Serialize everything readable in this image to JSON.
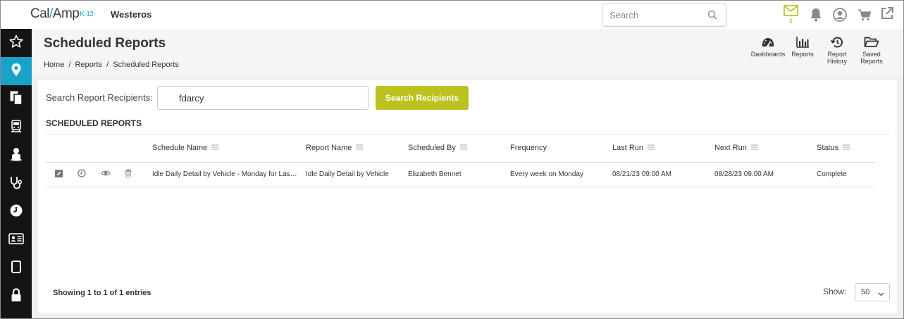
{
  "brand": {
    "name": "Cal",
    "name2": "Amp",
    "suffix": "K-12",
    "org": "Westeros",
    "accent": "#1aa3c8",
    "primary": "#bcc21f"
  },
  "topbar": {
    "search_placeholder": "Search",
    "mail_count": "1",
    "icons": [
      "mail-icon",
      "bell-icon",
      "user-circle-icon",
      "cart-icon",
      "external-link-icon"
    ]
  },
  "leftnav": {
    "items": [
      "star-icon",
      "map-pin-icon",
      "documents-icon",
      "bus-icon",
      "driver-icon",
      "stethoscope-icon",
      "clock-icon",
      "id-card-icon",
      "tablet-icon",
      "lock-icon"
    ],
    "active": "map-pin-icon"
  },
  "header": {
    "title": "Scheduled Reports",
    "breadcrumb": [
      "Home",
      "/",
      "Reports",
      "/",
      "Scheduled Reports"
    ],
    "quick_links": [
      {
        "label": "Dashboards",
        "icon": "dashboard-gauge-icon"
      },
      {
        "label": "Reports",
        "icon": "bar-chart-icon"
      },
      {
        "label": "Report History",
        "icon": "history-icon"
      },
      {
        "label": "Saved Reports",
        "icon": "folder-open-icon"
      }
    ]
  },
  "recipients": {
    "label": "Search Report Recipients:",
    "value": "fdarcy",
    "button": "Search Recipients"
  },
  "section_title": "SCHEDULED REPORTS",
  "table": {
    "columns": [
      "Schedule Name",
      "Report Name",
      "Scheduled By",
      "Frequency",
      "Last Run",
      "Next Run",
      "Status"
    ],
    "rows": [
      {
        "schedule_name": "Idle Daily Detail by Vehicle - Monday for Last Week",
        "report_name": "Idle Daily Detail by Vehicle",
        "scheduled_by": "Elizabeth Bennet",
        "frequency": "Every week on Monday",
        "last_run": "08/21/23 09:00 AM",
        "next_run": "08/28/23 09:00 AM",
        "status": "Complete",
        "actions": [
          "edit-icon",
          "clock-icon",
          "eye-icon",
          "trash-icon"
        ]
      }
    ]
  },
  "footer": {
    "entries": "Showing 1 to 1 of 1 entries",
    "show_label": "Show:",
    "show_value": "50"
  }
}
